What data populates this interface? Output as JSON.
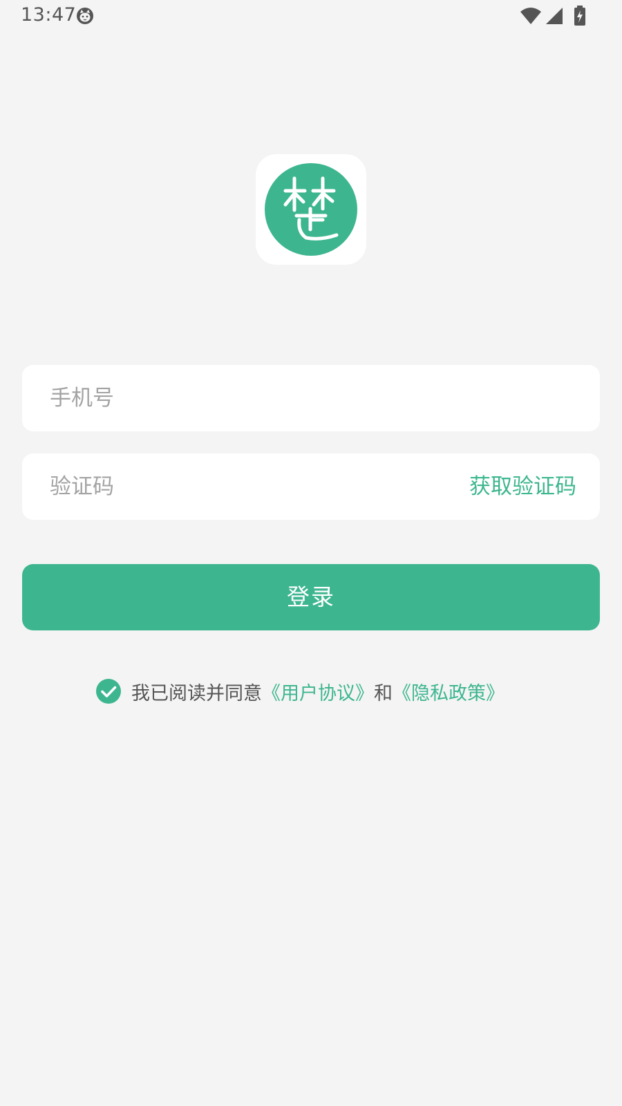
{
  "status_bar": {
    "time": "13:47",
    "icons": [
      "cat-face-icon",
      "wifi-icon",
      "cellular-signal-icon",
      "battery-charging-icon"
    ]
  },
  "logo": {
    "glyph": "楚",
    "icon": "app-logo-icon",
    "color": "#3db68f"
  },
  "form": {
    "phone_placeholder": "手机号",
    "code_placeholder": "验证码",
    "get_code_label": "获取验证码",
    "login_label": "登录"
  },
  "agreement": {
    "checked": true,
    "prefix": "我已阅读并同意",
    "user_agreement": "《用户协议》",
    "conjunction": "和",
    "privacy_policy": "《隐私政策》"
  },
  "colors": {
    "accent": "#3db68f",
    "background": "#f4f4f4"
  }
}
